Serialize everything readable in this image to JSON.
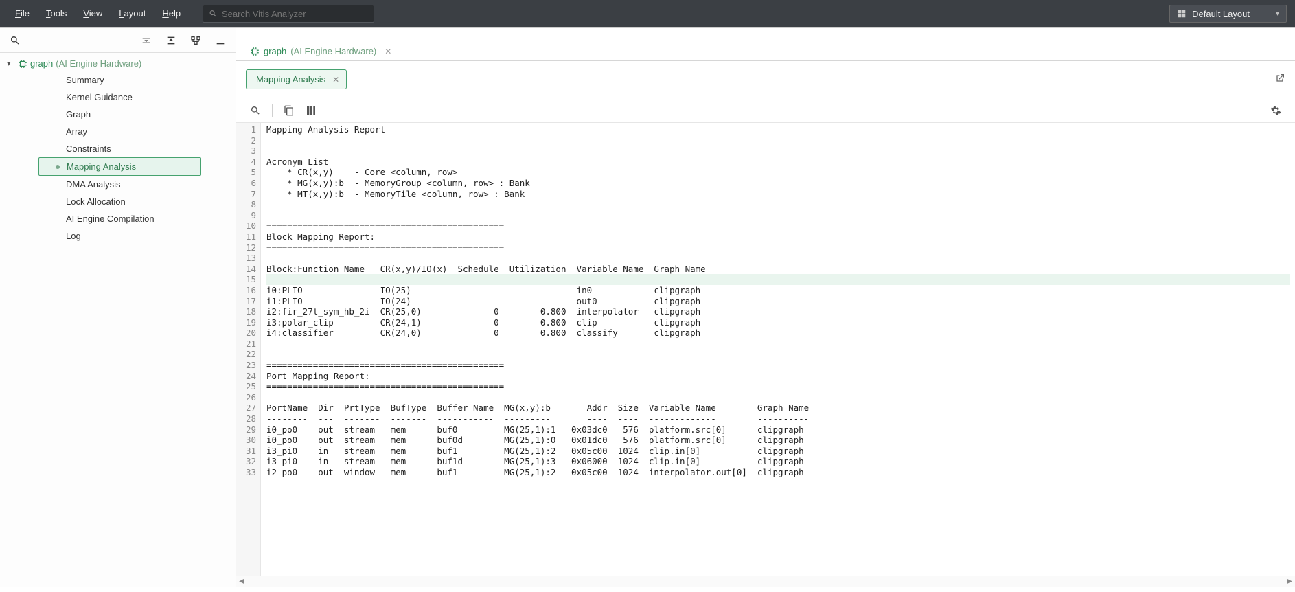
{
  "menubar": {
    "file": {
      "mn": "F",
      "rest": "ile"
    },
    "tools": {
      "mn": "T",
      "rest": "ools"
    },
    "view": {
      "mn": "V",
      "rest": "iew"
    },
    "layout": {
      "mn": "L",
      "rest": "ayout"
    },
    "help": {
      "mn": "H",
      "rest": "elp"
    },
    "search_placeholder": "Search Vitis Analyzer",
    "layout_button": "Default Layout"
  },
  "sidebar": {
    "root": {
      "name": "graph",
      "sub": "(AI Engine Hardware)"
    },
    "items": [
      {
        "label": "Summary"
      },
      {
        "label": "Kernel Guidance"
      },
      {
        "label": "Graph"
      },
      {
        "label": "Array"
      },
      {
        "label": "Constraints"
      },
      {
        "label": "Mapping Analysis",
        "selected": true
      },
      {
        "label": "DMA Analysis"
      },
      {
        "label": "Lock Allocation"
      },
      {
        "label": "AI Engine Compilation"
      },
      {
        "label": "Log"
      }
    ]
  },
  "doc": {
    "title": "graph",
    "sub": "(AI Engine Hardware)",
    "inner_tab": "Mapping Analysis"
  },
  "report_lines": [
    "Mapping Analysis Report",
    "",
    "",
    "Acronym List",
    "    * CR(x,y)    - Core <column, row>",
    "    * MG(x,y):b  - MemoryGroup <column, row> : Bank",
    "    * MT(x,y):b  - MemoryTile <column, row> : Bank",
    "",
    "",
    "==============================================",
    "Block Mapping Report:",
    "==============================================",
    "",
    "Block:Function Name   CR(x,y)/IO(x)  Schedule  Utilization  Variable Name  Graph Name",
    "-------------------   -------------  --------  -----------  -------------  ----------",
    "i0:PLIO               IO(25)                                in0            clipgraph",
    "i1:PLIO               IO(24)                                out0           clipgraph",
    "i2:fir_27t_sym_hb_2i  CR(25,0)              0        0.800  interpolator   clipgraph",
    "i3:polar_clip         CR(24,1)              0        0.800  clip           clipgraph",
    "i4:classifier         CR(24,0)              0        0.800  classify       clipgraph",
    "",
    "",
    "==============================================",
    "Port Mapping Report:",
    "==============================================",
    "",
    "PortName  Dir  PrtType  BufType  Buffer Name  MG(x,y):b       Addr  Size  Variable Name        Graph Name",
    "--------  ---  -------  -------  -----------  ---------       ----  ----  -------------        ----------",
    "i0_po0    out  stream   mem      buf0         MG(25,1):1   0x03dc0   576  platform.src[0]      clipgraph",
    "i0_po0    out  stream   mem      buf0d        MG(25,1):0   0x01dc0   576  platform.src[0]      clipgraph",
    "i3_pi0    in   stream   mem      buf1         MG(25,1):2   0x05c00  1024  clip.in[0]           clipgraph",
    "i3_pi0    in   stream   mem      buf1d        MG(25,1):3   0x06000  1024  clip.in[0]           clipgraph",
    "i2_po0    out  window   mem      buf1         MG(25,1):2   0x05c00  1024  interpolator.out[0]  clipgraph"
  ],
  "highlight_line_index": 14
}
